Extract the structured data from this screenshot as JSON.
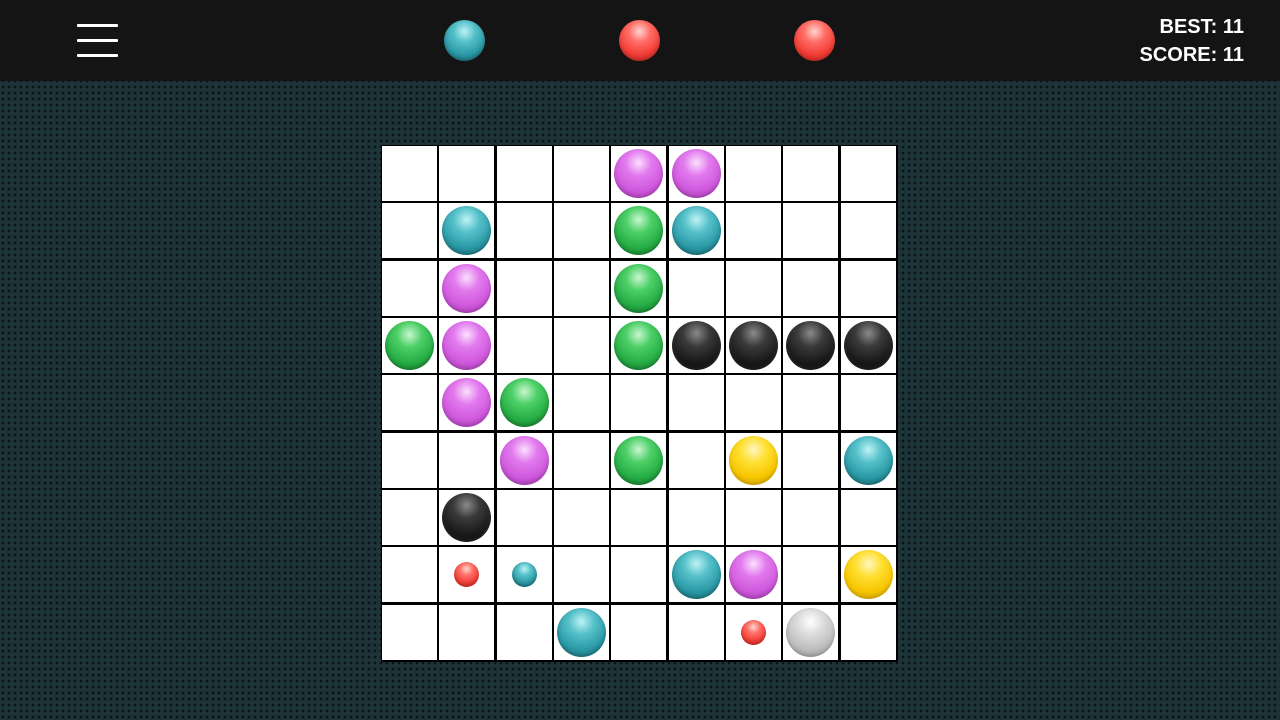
{
  "header": {
    "best_label": "BEST: 11",
    "score_label": "SCORE: 11",
    "menu_icon": "hamburger-menu-icon",
    "next_balls": [
      "teal",
      "red",
      "red"
    ]
  },
  "colors": {
    "teal": "#2a9aa6",
    "red": "#f23d36",
    "purple": "#cf58dc",
    "green": "#26ad45",
    "black": "#1a1a1a",
    "yellow": "#f7c600",
    "gray": "#bdbdbd",
    "background": "#1d3438",
    "topbar": "#141414"
  },
  "board": {
    "size": 9,
    "balls": [
      {
        "row": 0,
        "col": 4,
        "color": "purple"
      },
      {
        "row": 0,
        "col": 5,
        "color": "purple"
      },
      {
        "row": 1,
        "col": 1,
        "color": "teal"
      },
      {
        "row": 1,
        "col": 4,
        "color": "green"
      },
      {
        "row": 1,
        "col": 5,
        "color": "teal"
      },
      {
        "row": 2,
        "col": 1,
        "color": "purple"
      },
      {
        "row": 2,
        "col": 4,
        "color": "green"
      },
      {
        "row": 3,
        "col": 0,
        "color": "green"
      },
      {
        "row": 3,
        "col": 1,
        "color": "purple"
      },
      {
        "row": 3,
        "col": 4,
        "color": "green"
      },
      {
        "row": 3,
        "col": 5,
        "color": "black"
      },
      {
        "row": 3,
        "col": 6,
        "color": "black"
      },
      {
        "row": 3,
        "col": 7,
        "color": "black"
      },
      {
        "row": 3,
        "col": 8,
        "color": "black"
      },
      {
        "row": 4,
        "col": 1,
        "color": "purple"
      },
      {
        "row": 4,
        "col": 2,
        "color": "green"
      },
      {
        "row": 5,
        "col": 2,
        "color": "purple"
      },
      {
        "row": 5,
        "col": 4,
        "color": "green"
      },
      {
        "row": 5,
        "col": 6,
        "color": "yellow"
      },
      {
        "row": 5,
        "col": 8,
        "color": "teal"
      },
      {
        "row": 6,
        "col": 1,
        "color": "black"
      },
      {
        "row": 7,
        "col": 5,
        "color": "teal"
      },
      {
        "row": 7,
        "col": 6,
        "color": "purple"
      },
      {
        "row": 7,
        "col": 8,
        "color": "yellow"
      },
      {
        "row": 8,
        "col": 3,
        "color": "teal"
      },
      {
        "row": 8,
        "col": 7,
        "color": "gray"
      }
    ],
    "preview_balls": [
      {
        "row": 7,
        "col": 1,
        "color": "red"
      },
      {
        "row": 7,
        "col": 2,
        "color": "teal"
      },
      {
        "row": 8,
        "col": 6,
        "color": "red"
      }
    ]
  }
}
